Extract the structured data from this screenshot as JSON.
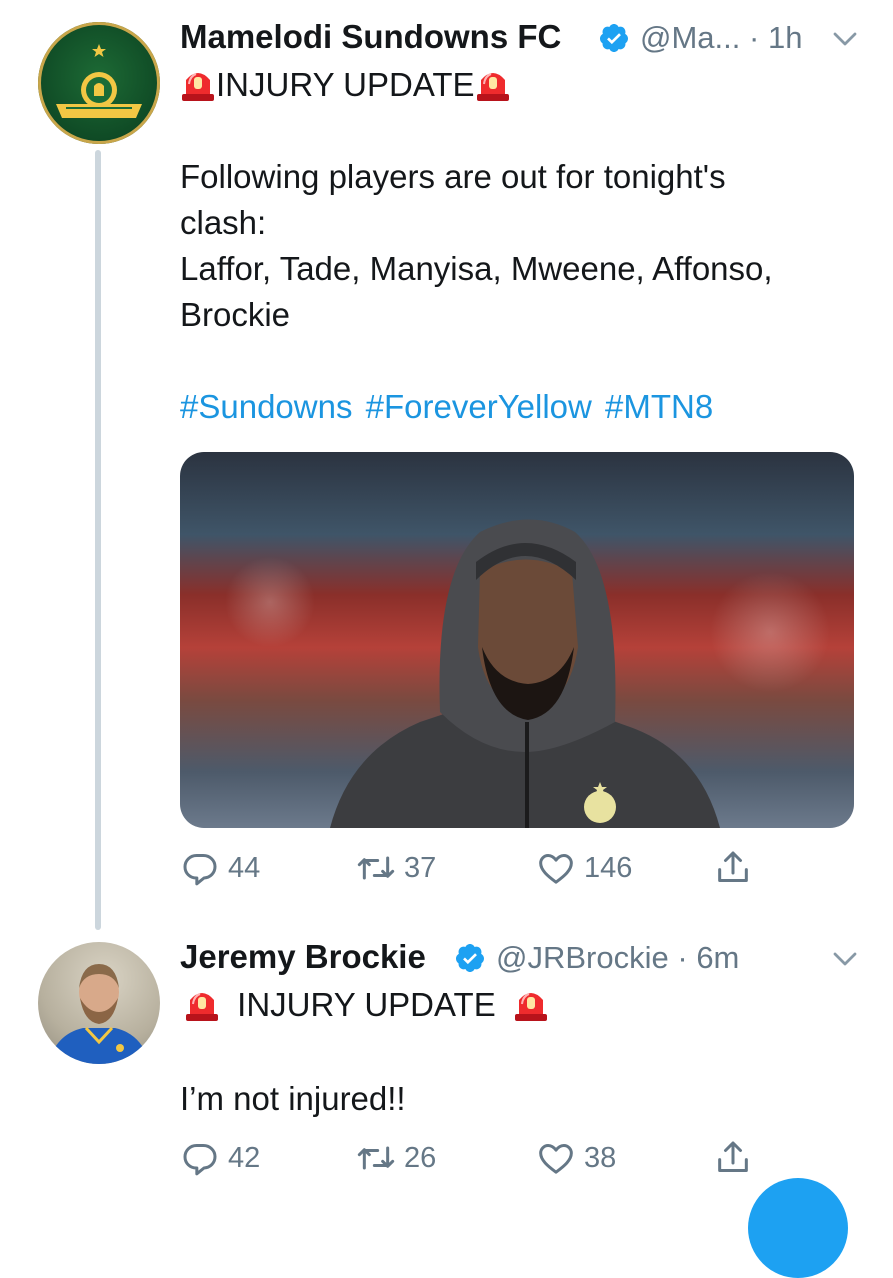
{
  "tweet1": {
    "name": "Mamelodi Sundowns FC",
    "handle": "@Ma...",
    "separator": "·",
    "time": "1h",
    "headline": "INJURY UPDATE",
    "body_lines": [
      "Following players are out for tonight's",
      "clash:",
      "Laffor, Tade, Manyisa, Mweene, Affonso,",
      "Brockie"
    ],
    "hashtags": [
      "#Sundowns",
      "#ForeverYellow",
      "#MTN8"
    ],
    "replies": "44",
    "retweets": "37",
    "likes": "146"
  },
  "tweet2": {
    "name": "Jeremy Brockie",
    "handle": "@JRBrockie",
    "separator": "·",
    "time": "6m",
    "headline": "INJURY UPDATE",
    "body": "I’m not injured!!",
    "replies": "42",
    "retweets": "26",
    "likes": "38"
  },
  "colors": {
    "link": "#1b95e0",
    "secondary_text": "#657786",
    "verified": "#1da1f2",
    "thread_line": "#ccd6dd"
  },
  "icons": [
    "verified-badge-icon",
    "chevron-down-icon",
    "siren-emoji",
    "reply-icon",
    "retweet-icon",
    "like-icon",
    "share-icon"
  ]
}
